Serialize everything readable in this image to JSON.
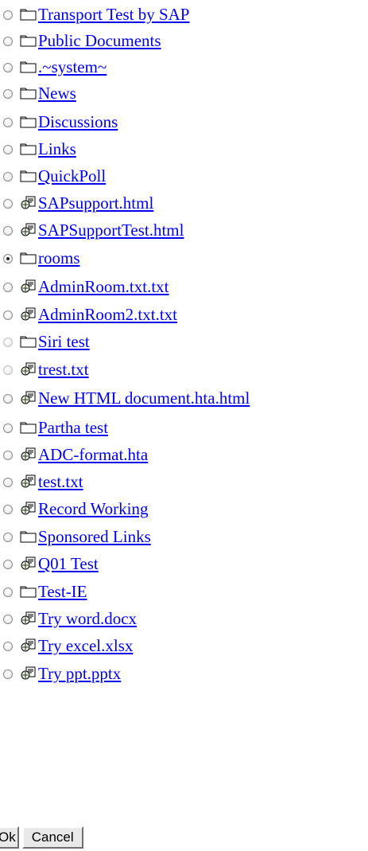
{
  "items": [
    {
      "label": "Transport Test by SAP",
      "icon": "folder-icon",
      "selected": false
    },
    {
      "label": "Public Documents",
      "icon": "folder-icon",
      "selected": false
    },
    {
      "label": ".~system~",
      "icon": "folder-icon",
      "selected": false
    },
    {
      "label": "News",
      "icon": "folder-icon",
      "selected": false
    },
    {
      "label": "Discussions",
      "icon": "folder-icon",
      "selected": false
    },
    {
      "label": "Links",
      "icon": "folder-icon",
      "selected": false
    },
    {
      "label": "QuickPoll",
      "icon": "folder-icon",
      "selected": false
    },
    {
      "label": "SAPsupport.html",
      "icon": "document-icon",
      "selected": false
    },
    {
      "label": "SAPSupportTest.html",
      "icon": "document-icon",
      "selected": false
    },
    {
      "label": "rooms",
      "icon": "folder-icon",
      "selected": true
    },
    {
      "label": "AdminRoom.txt.txt",
      "icon": "document-icon",
      "selected": false
    },
    {
      "label": "AdminRoom2.txt.txt",
      "icon": "document-icon",
      "selected": false
    },
    {
      "label": "Siri test",
      "icon": "folder-icon",
      "selected": false
    },
    {
      "label": "trest.txt",
      "icon": "document-icon",
      "selected": false
    },
    {
      "label": "New HTML document.hta.html",
      "icon": "document-icon",
      "selected": false
    },
    {
      "label": "Partha test",
      "icon": "folder-icon",
      "selected": false
    },
    {
      "label": "ADC-format.hta",
      "icon": "document-icon",
      "selected": false
    },
    {
      "label": "test.txt",
      "icon": "document-icon",
      "selected": false
    },
    {
      "label": "Record Working",
      "icon": "document-icon",
      "selected": false
    },
    {
      "label": "Sponsored Links",
      "icon": "folder-icon",
      "selected": false
    },
    {
      "label": " Q01 Test",
      "icon": "document-icon",
      "selected": false
    },
    {
      "label": "Test-IE",
      "icon": "folder-icon",
      "selected": false
    },
    {
      "label": "Try word.docx",
      "icon": "document-icon",
      "selected": false
    },
    {
      "label": "Try excel.xlsx",
      "icon": "document-icon",
      "selected": false
    },
    {
      "label": "Try ppt.pptx",
      "icon": "document-icon",
      "selected": false
    }
  ],
  "buttons": {
    "ok_label": "Ok",
    "cancel_label": "Cancel"
  }
}
